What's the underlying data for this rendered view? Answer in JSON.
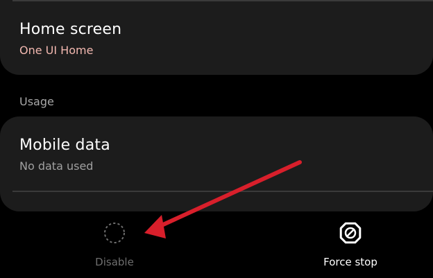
{
  "settings": {
    "home_screen": {
      "title": "Home screen",
      "value": "One UI Home",
      "value_color": "#f2b8b0"
    },
    "usage_section": {
      "label": "Usage"
    },
    "mobile_data": {
      "title": "Mobile data",
      "value": "No data used"
    }
  },
  "bottom_bar": {
    "disable": {
      "label": "Disable",
      "icon": "disable-dashed-circle-icon",
      "enabled": false
    },
    "force_stop": {
      "label": "Force stop",
      "icon": "force-stop-icon",
      "enabled": true
    }
  },
  "annotation": {
    "icon": "red-arrow-icon",
    "color": "#d81f2b"
  }
}
